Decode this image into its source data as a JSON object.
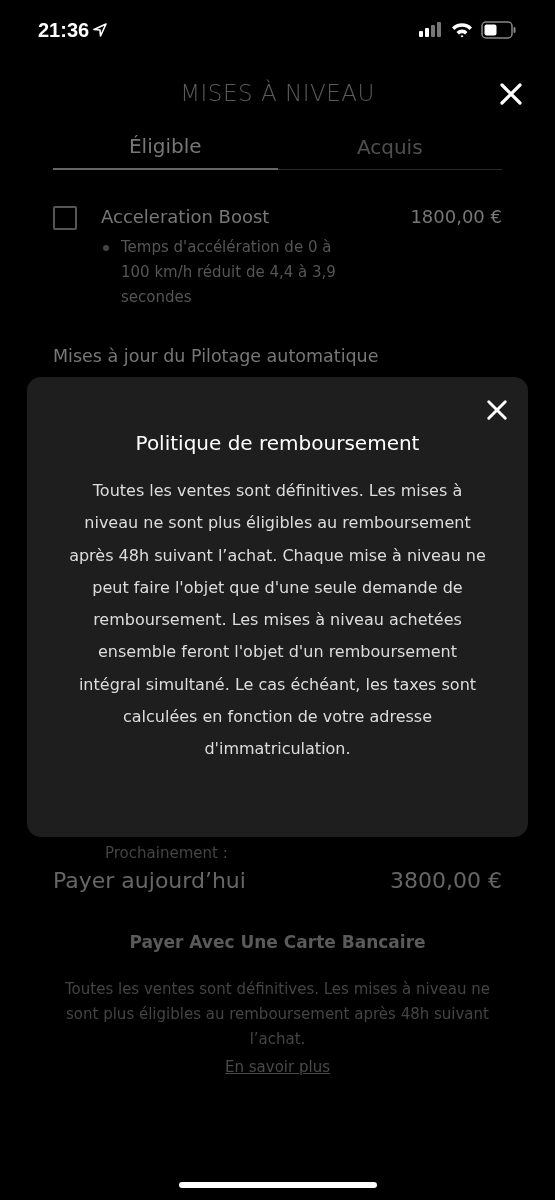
{
  "status_bar": {
    "time": "21:36"
  },
  "header": {
    "title": "MISES À NIVEAU"
  },
  "tabs": [
    {
      "label": "Éligible",
      "selected": true
    },
    {
      "label": "Acquis",
      "selected": false
    }
  ],
  "upgrades": [
    {
      "name": "Acceleration Boost",
      "price": "1800,00 €",
      "checked": false,
      "details": [
        "Temps d'accélération de 0 à 100 km/h réduit de 4,4 à 3,9 secondes"
      ]
    }
  ],
  "section_heading": "Mises à jour du Pilotage automatique",
  "coming_soon_label": "Prochainement :",
  "total": {
    "label": "Payer aujourd’hui",
    "amount": "3800,00 €"
  },
  "pay_button": "Payer Avec Une Carte Bancaire",
  "disclaimer": "Toutes les ventes sont définitives. Les mises à niveau ne sont plus éligibles au remboursement après 48h suivant l’achat.",
  "learn_more_link": "En savoir plus",
  "modal": {
    "title": "Politique de remboursement",
    "body": "Toutes les ventes sont définitives. Les mises à niveau ne sont plus éligibles au remboursement après 48h suivant l’achat. Chaque mise à niveau ne peut faire l'objet que d'une seule demande de remboursement. Les mises à niveau achetées ensemble feront l'objet d'un remboursement intégral simultané. Le cas échéant, les taxes sont calculées en fonction de votre adresse d'immatriculation."
  }
}
